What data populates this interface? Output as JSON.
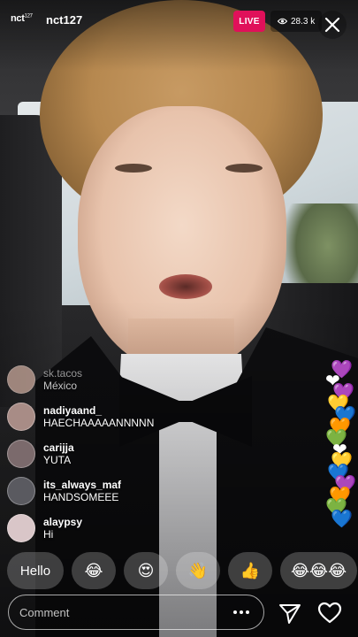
{
  "header": {
    "brand_logo": "nct",
    "brand_logo_sup": "127",
    "username": "nct127",
    "live_label": "LIVE",
    "viewer_count": "28.3 k"
  },
  "comments": [
    {
      "user": "sk.tacos",
      "message": "México",
      "avatar_color": "#c9a89b",
      "faded": true
    },
    {
      "user": "nadiyaand_",
      "message": "HAECHAAAAANNNNN",
      "avatar_color": "#a88c86"
    },
    {
      "user": "carijja",
      "message": "YUTA",
      "avatar_color": "#7b6a6c"
    },
    {
      "user": "its_always_maf",
      "message": "HANDSOMEEE",
      "avatar_color": "#5a5a60"
    },
    {
      "user": "alaypsy",
      "message": "Hi",
      "avatar_color": "#d9c6c8"
    }
  ],
  "hearts": [
    "💜",
    "❤",
    "💜",
    "💛",
    "💙",
    "🧡",
    "💚",
    "❤",
    "💛",
    "💙",
    "💜",
    "🧡",
    "💚",
    "💙"
  ],
  "reactions": [
    {
      "label": "Hello",
      "type": "text"
    },
    {
      "label": "😂",
      "type": "emoji"
    },
    {
      "label": "😍",
      "type": "emoji"
    },
    {
      "label": "👋",
      "type": "emoji"
    },
    {
      "label": "👍",
      "type": "emoji"
    },
    {
      "label": "😂😂😂",
      "type": "emoji"
    }
  ],
  "comment_bar": {
    "placeholder": "Comment"
  },
  "colors": {
    "live_badge": "#e0105a"
  }
}
